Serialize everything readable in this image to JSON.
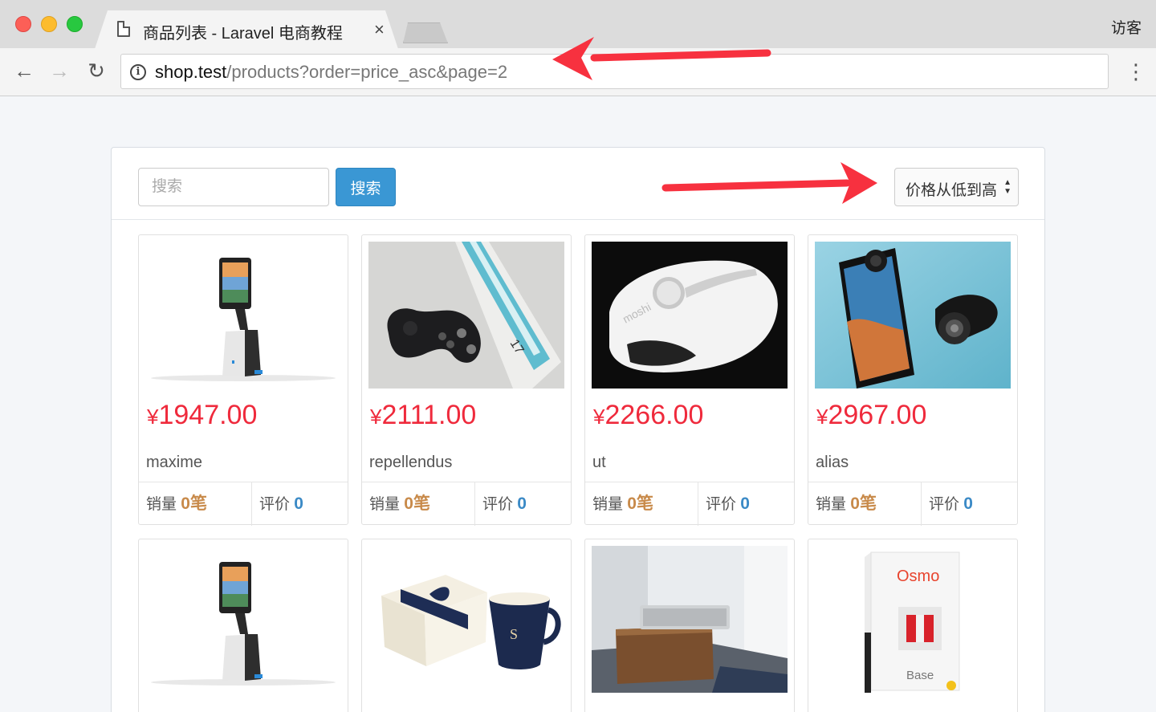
{
  "browser": {
    "tab_title": "商品列表 - Laravel 电商教程",
    "tab_close": "×",
    "profile_label": "访客",
    "url_host": "shop.test",
    "url_path": "/products?order=price_asc&page=2",
    "back_glyph": "←",
    "forward_glyph": "→",
    "reload_glyph": "↻",
    "menu_glyph": "⋮",
    "info_glyph": "i"
  },
  "search": {
    "placeholder": "搜索",
    "button_label": "搜索"
  },
  "sort": {
    "selected_label": "价格从低到高"
  },
  "products": [
    {
      "price_symbol": "¥",
      "price": "1947.00",
      "name": "maxime",
      "sales_label": "销量",
      "sales": "0笔",
      "reviews_label": "评价",
      "reviews": "0"
    },
    {
      "price_symbol": "¥",
      "price": "2111.00",
      "name": "repellendus",
      "sales_label": "销量",
      "sales": "0笔",
      "reviews_label": "评价",
      "reviews": "0"
    },
    {
      "price_symbol": "¥",
      "price": "2266.00",
      "name": "ut",
      "sales_label": "销量",
      "sales": "0笔",
      "reviews_label": "评价",
      "reviews": "0"
    },
    {
      "price_symbol": "¥",
      "price": "2967.00",
      "name": "alias",
      "sales_label": "销量",
      "sales": "0笔",
      "reviews_label": "评价",
      "reviews": "0"
    }
  ],
  "thumb_text": {
    "osmo_logo": "Osmo",
    "osmo_base": "Base",
    "moshi": "moshi",
    "box_17": "17"
  },
  "colors": {
    "price_red": "#ef2a3c",
    "search_blue": "#3a97d4",
    "annotation_red": "#f7313f",
    "sales_orange": "#c88a4a",
    "reviews_blue": "#3b8ac6"
  }
}
